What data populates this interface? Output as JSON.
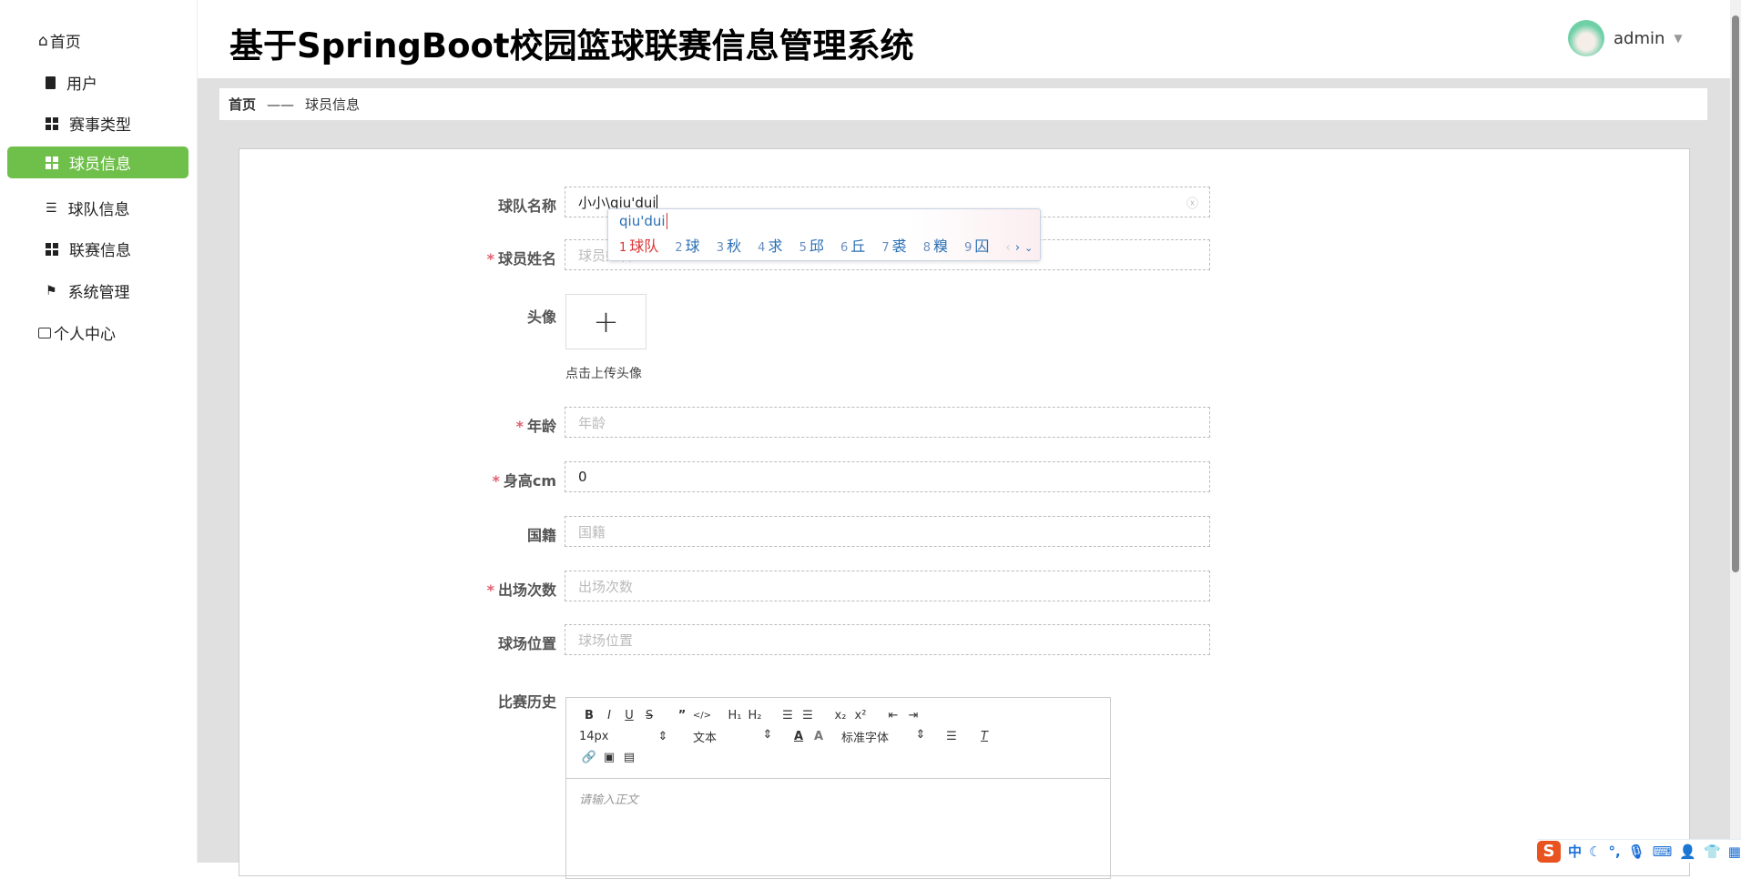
{
  "header": {
    "title": "基于SpringBoot校园篮球联赛信息管理系统",
    "user": "admin"
  },
  "sidebar": {
    "items": [
      {
        "label": "首页",
        "icon": "home-icon"
      },
      {
        "label": "用户",
        "icon": "clipboard-icon"
      },
      {
        "label": "赛事类型",
        "icon": "grid-icon"
      },
      {
        "label": "球员信息",
        "icon": "grid-icon",
        "active": true
      },
      {
        "label": "球队信息",
        "icon": "list-icon"
      },
      {
        "label": "联赛信息",
        "icon": "grid-icon"
      },
      {
        "label": "系统管理",
        "icon": "flag-icon"
      },
      {
        "label": "个人中心",
        "icon": "card-icon"
      }
    ]
  },
  "breadcrumb": {
    "home": "首页",
    "sep": "——",
    "current": "球员信息"
  },
  "form": {
    "team_name": {
      "label": "球队名称",
      "value": "小小\\qiu'dui"
    },
    "player_name": {
      "label": "球员姓名",
      "placeholder": "球员姓名"
    },
    "avatar": {
      "label": "头像",
      "hint": "点击上传头像",
      "plus": "+"
    },
    "age": {
      "label": "年龄",
      "placeholder": "年龄"
    },
    "height": {
      "label": "身高cm",
      "value": "0"
    },
    "nationality": {
      "label": "国籍",
      "placeholder": "国籍"
    },
    "appearances": {
      "label": "出场次数",
      "placeholder": "出场次数"
    },
    "position": {
      "label": "球场位置",
      "placeholder": "球场位置"
    },
    "history": {
      "label": "比赛历史",
      "placeholder": "请输入正文",
      "font_size": "14px",
      "header_select": "文本",
      "font_family": "标准字体"
    }
  },
  "ime": {
    "composition": "qiu'dui",
    "candidates": [
      "球队",
      "球",
      "秋",
      "求",
      "邱",
      "丘",
      "裘",
      "糗",
      "囚"
    ]
  },
  "ime_bar": {
    "mode": "中"
  }
}
